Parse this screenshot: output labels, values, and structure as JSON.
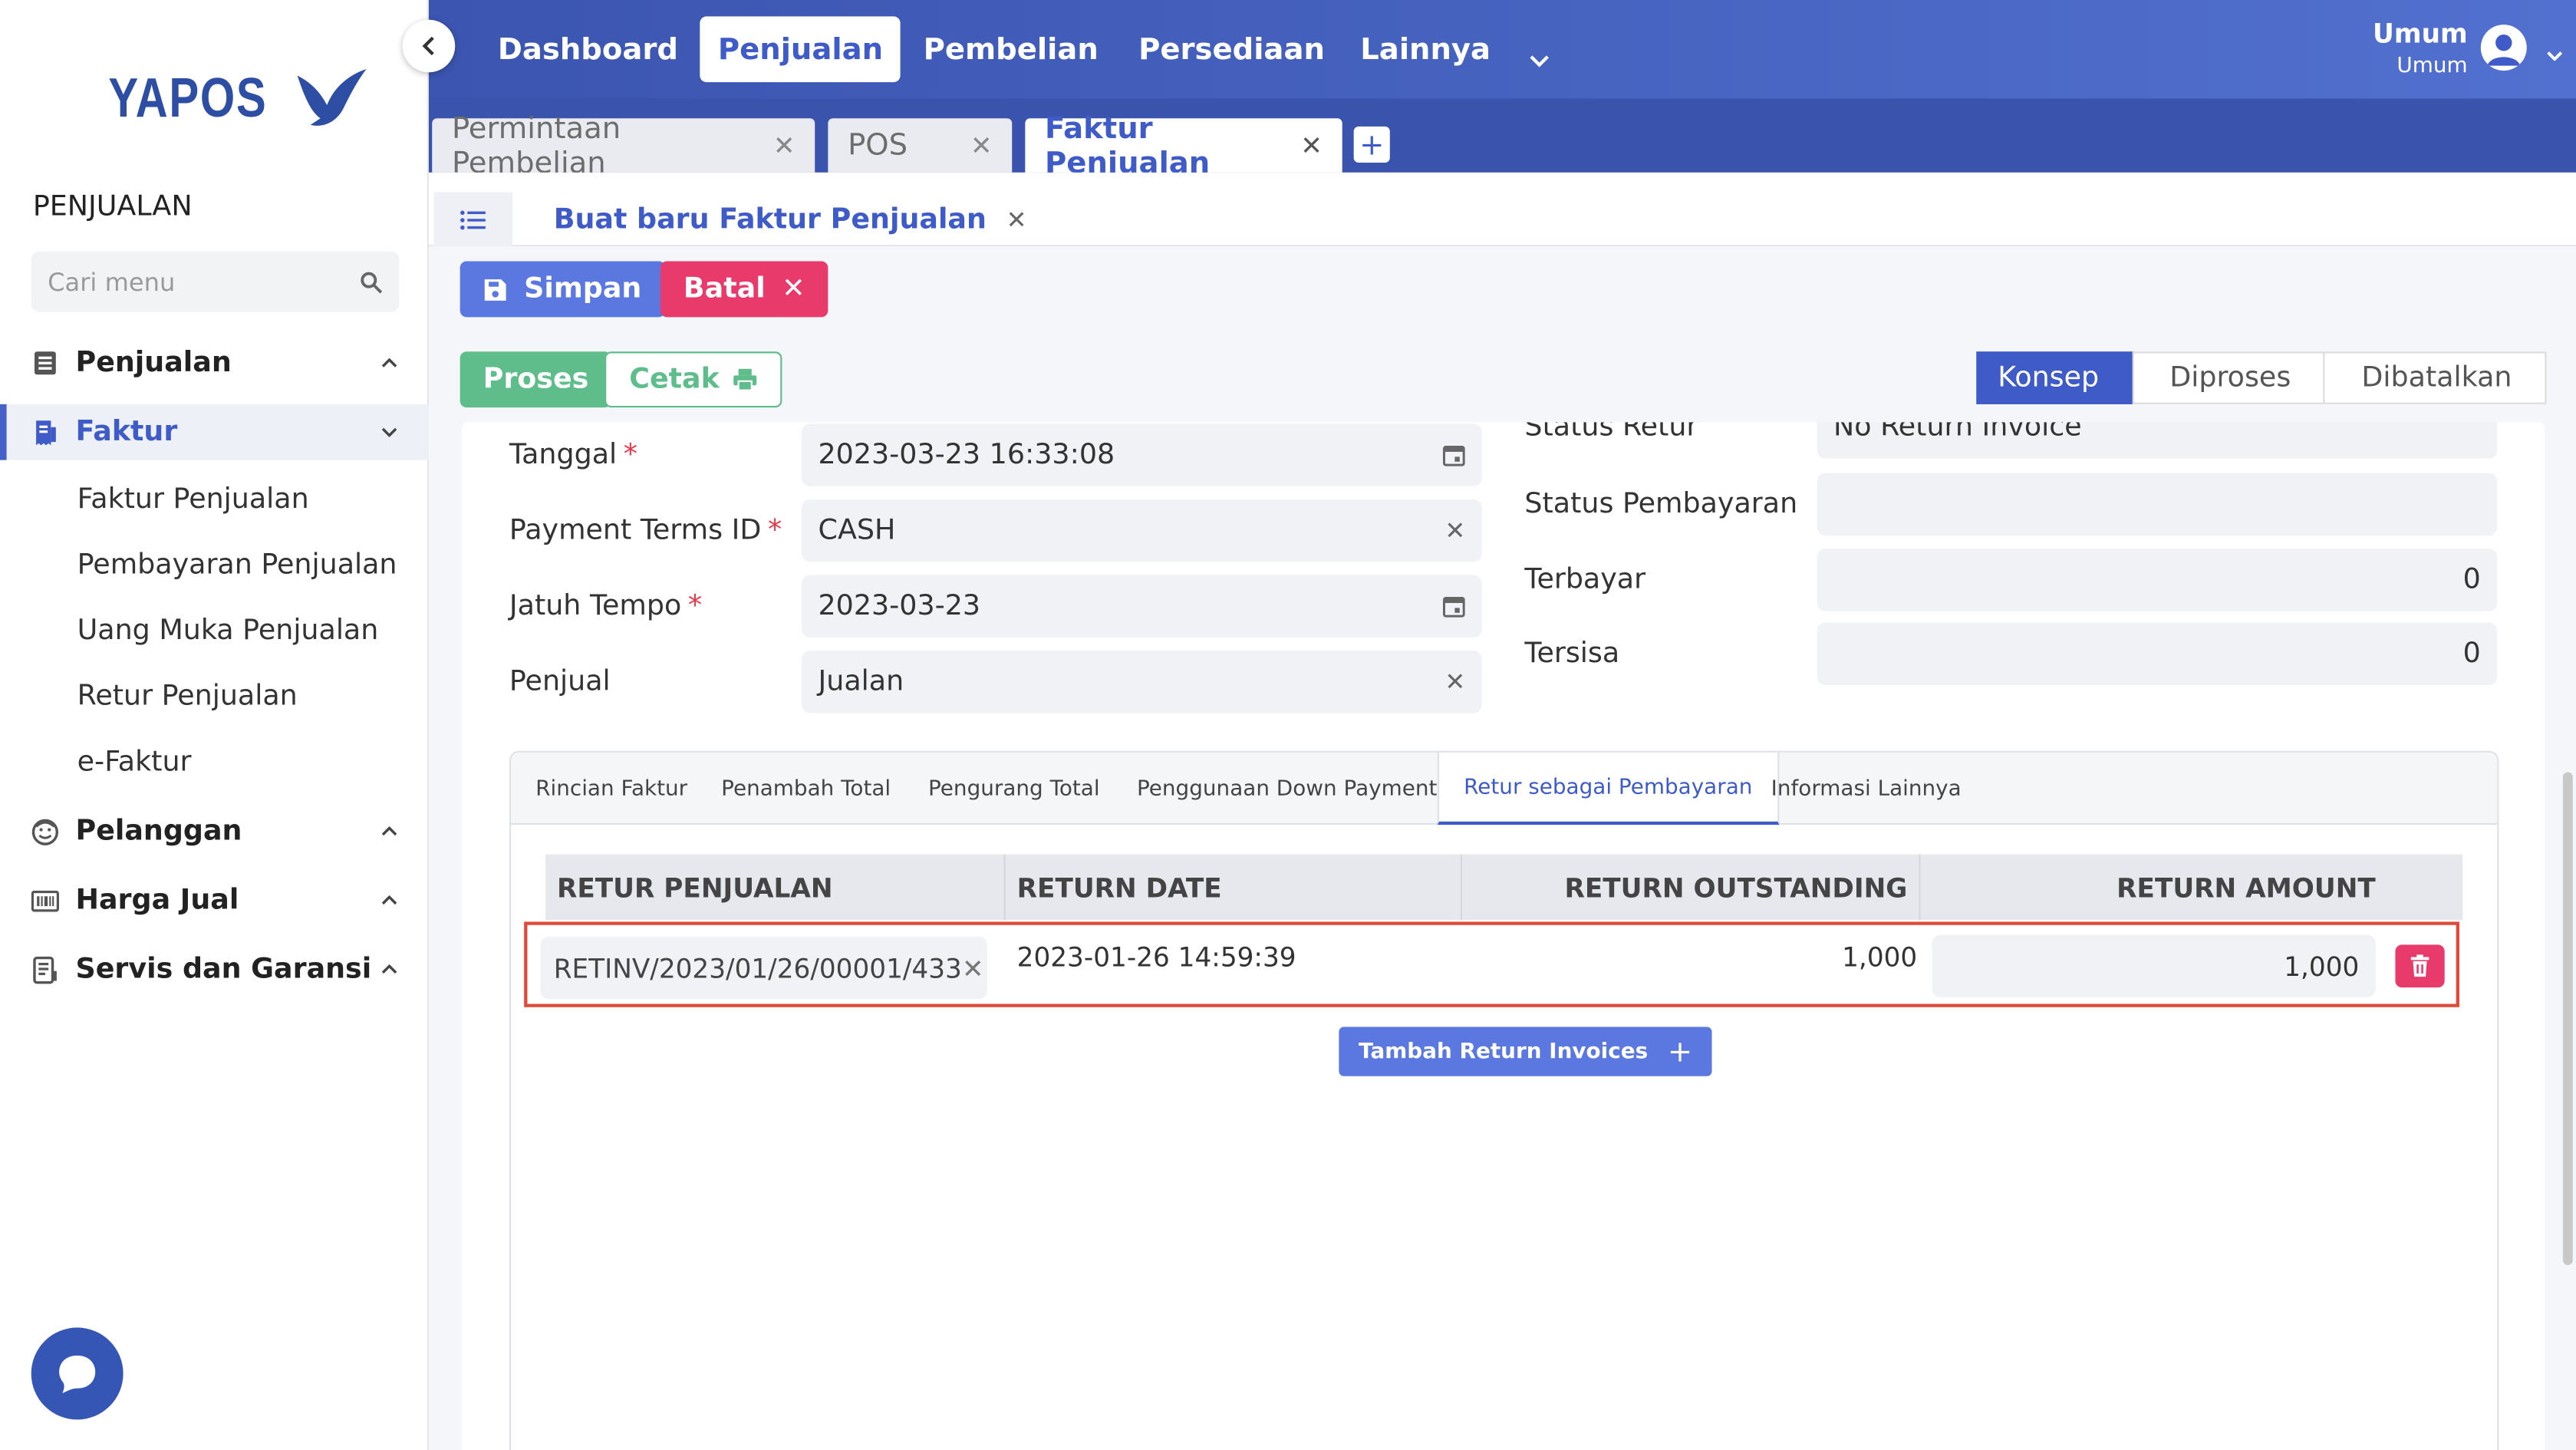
{
  "sidebar": {
    "logo_text": "YAPOS",
    "section_title": "PENJUALAN",
    "search_placeholder": "Cari menu",
    "groups": [
      {
        "label": "Penjualan",
        "icon": "document-list-icon"
      },
      {
        "label": "Faktur",
        "icon": "receipt-icon"
      },
      {
        "label": "Pelanggan",
        "icon": "smiley-face-icon"
      },
      {
        "label": "Harga Jual",
        "icon": "barcode-icon"
      },
      {
        "label": "Servis dan Garansi",
        "icon": "service-icon"
      }
    ],
    "faktur_items": [
      "Faktur Penjualan",
      "Pembayaran Penjualan",
      "Uang Muka Penjualan",
      "Retur Penjualan",
      "e-Faktur"
    ]
  },
  "topnav": {
    "items": [
      "Dashboard",
      "Penjualan",
      "Pembelian",
      "Persediaan",
      "Lainnya"
    ],
    "active": "Penjualan",
    "user_name": "Umum",
    "user_role": "Umum"
  },
  "window_tabs": [
    "Permintaan Pembelian",
    "POS",
    "Faktur Penjualan"
  ],
  "active_window_tab": "Faktur Penjualan",
  "doc_tab": "Buat baru Faktur Penjualan",
  "toolbar": {
    "save_label": "Simpan",
    "cancel_label": "Batal",
    "process_label": "Proses",
    "print_label": "Cetak"
  },
  "status_steps": [
    "Konsep",
    "Diproses",
    "Dibatalkan"
  ],
  "active_step": "Konsep",
  "form": {
    "tanggal_label": "Tanggal",
    "tanggal_value": "2023-03-23  16:33:08",
    "payment_terms_label": "Payment Terms ID",
    "payment_terms_value": "CASH",
    "jatuh_tempo_label": "Jatuh Tempo",
    "jatuh_tempo_value": "2023-03-23",
    "penjual_label": "Penjual",
    "penjual_value": "Jualan",
    "status_retur_label": "Status Retur",
    "status_retur_value": "No Return Invoice",
    "status_pembayaran_label": "Status Pembayaran",
    "status_pembayaran_value": "",
    "terbayar_label": "Terbayar",
    "terbayar_value": "0",
    "tersisa_label": "Tersisa",
    "tersisa_value": "0"
  },
  "panel_tabs": [
    "Rincian Faktur",
    "Penambah Total",
    "Pengurang Total",
    "Penggunaan Down Payment",
    "Retur sebagai Pembayaran",
    "Informasi Lainnya"
  ],
  "active_panel_tab": "Retur sebagai Pembayaran",
  "table": {
    "headers": [
      "RETUR PENJUALAN",
      "RETURN DATE",
      "RETURN OUTSTANDING",
      "RETURN AMOUNT"
    ],
    "rows": [
      {
        "retur": "RETINV/2023/01/26/00001/433",
        "date": "2023-01-26  14:59:39",
        "outstanding": "1,000",
        "amount": "1,000"
      }
    ]
  },
  "add_button_label": "Tambah Return Invoices",
  "colors": {
    "primary": "#3e5bc7",
    "danger": "#e83a6b",
    "success": "#5ebd8a",
    "highlight": "#e04a3a"
  }
}
